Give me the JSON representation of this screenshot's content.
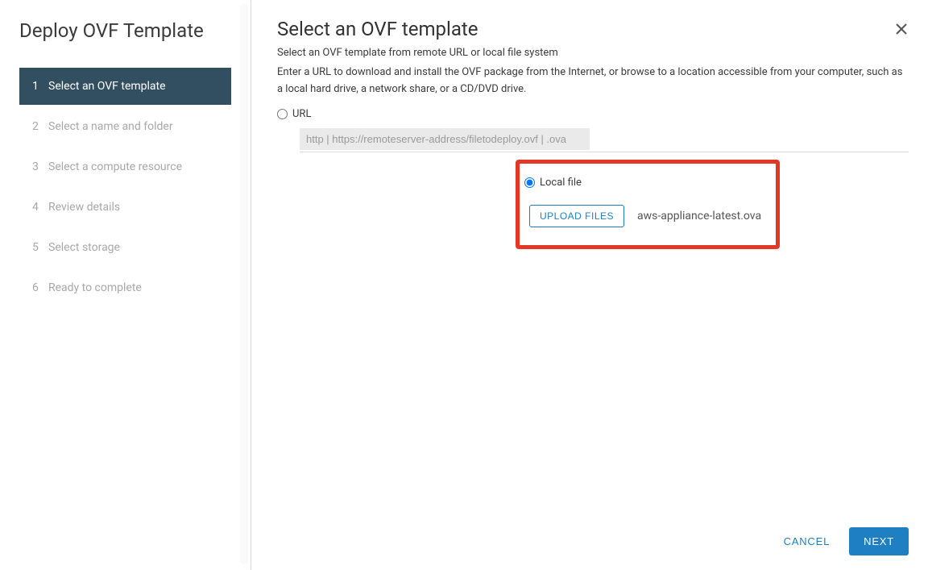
{
  "sidebar": {
    "title": "Deploy OVF Template",
    "steps": [
      {
        "num": "1",
        "label": "Select an OVF template",
        "active": true
      },
      {
        "num": "2",
        "label": "Select a name and folder",
        "active": false
      },
      {
        "num": "3",
        "label": "Select a compute resource",
        "active": false
      },
      {
        "num": "4",
        "label": "Review details",
        "active": false
      },
      {
        "num": "5",
        "label": "Select storage",
        "active": false
      },
      {
        "num": "6",
        "label": "Ready to complete",
        "active": false
      }
    ]
  },
  "main": {
    "title": "Select an OVF template",
    "subtitle1": "Select an OVF template from remote URL or local file system",
    "subtitle2": "Enter a URL to download and install the OVF package from the Internet, or browse to a location accessible from your computer, such as a local hard drive, a network share, or a CD/DVD drive.",
    "url_label": "URL",
    "url_placeholder": "http | https://remoteserver-address/filetodeploy.ovf | .ova",
    "url_value": "",
    "local_label": "Local file",
    "upload_label": "UPLOAD FILES",
    "uploaded_file": "aws-appliance-latest.ova",
    "selected_option": "local"
  },
  "footer": {
    "cancel": "CANCEL",
    "next": "NEXT"
  }
}
